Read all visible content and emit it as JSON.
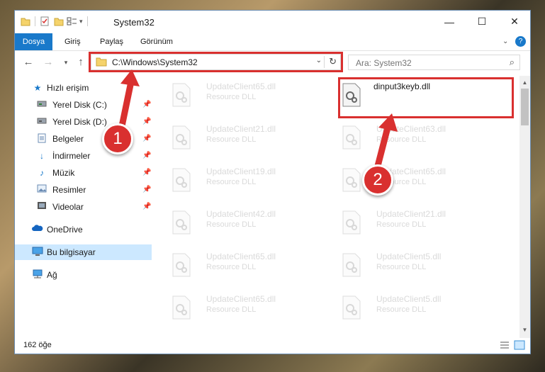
{
  "window": {
    "title": "System32",
    "controls": {
      "minimize": "—",
      "maximize": "☐",
      "close": "✕"
    }
  },
  "ribbon": {
    "tabs": [
      {
        "label": "Dosya"
      },
      {
        "label": "Giriş"
      },
      {
        "label": "Paylaş"
      },
      {
        "label": "Görünüm"
      }
    ]
  },
  "address": {
    "path": "C:\\Windows\\System32",
    "search_placeholder": "Ara: System32"
  },
  "sidebar": {
    "items": [
      {
        "label": "Hızlı erişim",
        "icon": "star-icon"
      },
      {
        "label": "Yerel Disk (C:)",
        "icon": "drive-icon"
      },
      {
        "label": "Yerel Disk (D:)",
        "icon": "drive-icon"
      },
      {
        "label": "Belgeler",
        "icon": "document-icon"
      },
      {
        "label": "İndirmeler",
        "icon": "download-icon"
      },
      {
        "label": "Müzik",
        "icon": "music-icon"
      },
      {
        "label": "Resimler",
        "icon": "pictures-icon"
      },
      {
        "label": "Videolar",
        "icon": "video-icon"
      },
      {
        "label": "OneDrive",
        "icon": "cloud-icon"
      },
      {
        "label": "Bu bilgisayar",
        "icon": "computer-icon"
      },
      {
        "label": "Ağ",
        "icon": "network-icon"
      }
    ]
  },
  "files": {
    "highlighted": {
      "name": "dinput3keyb.dll",
      "type": ""
    },
    "left": [
      {
        "name": "UpdateClient65.dll",
        "type": "Resource DLL"
      },
      {
        "name": "UpdateClient21.dll",
        "type": "Resource DLL"
      },
      {
        "name": "UpdateClient19.dll",
        "type": "Resource DLL"
      },
      {
        "name": "UpdateClient42.dll",
        "type": "Resource DLL"
      },
      {
        "name": "UpdateClient65.dll",
        "type": "Resource DLL"
      },
      {
        "name": "UpdateClient65.dll",
        "type": "Resource DLL"
      }
    ],
    "right": [
      {
        "name": "UpdateClient63.dll",
        "type": "Resource DLL"
      },
      {
        "name": "UpdateClient65.dll",
        "type": "Resource DLL"
      },
      {
        "name": "UpdateClient21.dll",
        "type": "Resource DLL"
      },
      {
        "name": "UpdateClient5.dll",
        "type": "Resource DLL"
      },
      {
        "name": "UpdateClient5.dll",
        "type": "Resource DLL"
      }
    ]
  },
  "status": {
    "item_count": "162 öğe"
  },
  "annotations": {
    "step1": "1",
    "step2": "2",
    "color": "#d9302f"
  },
  "colors": {
    "file_tab": "#1979ca",
    "selected_nav": "#cce8ff"
  }
}
